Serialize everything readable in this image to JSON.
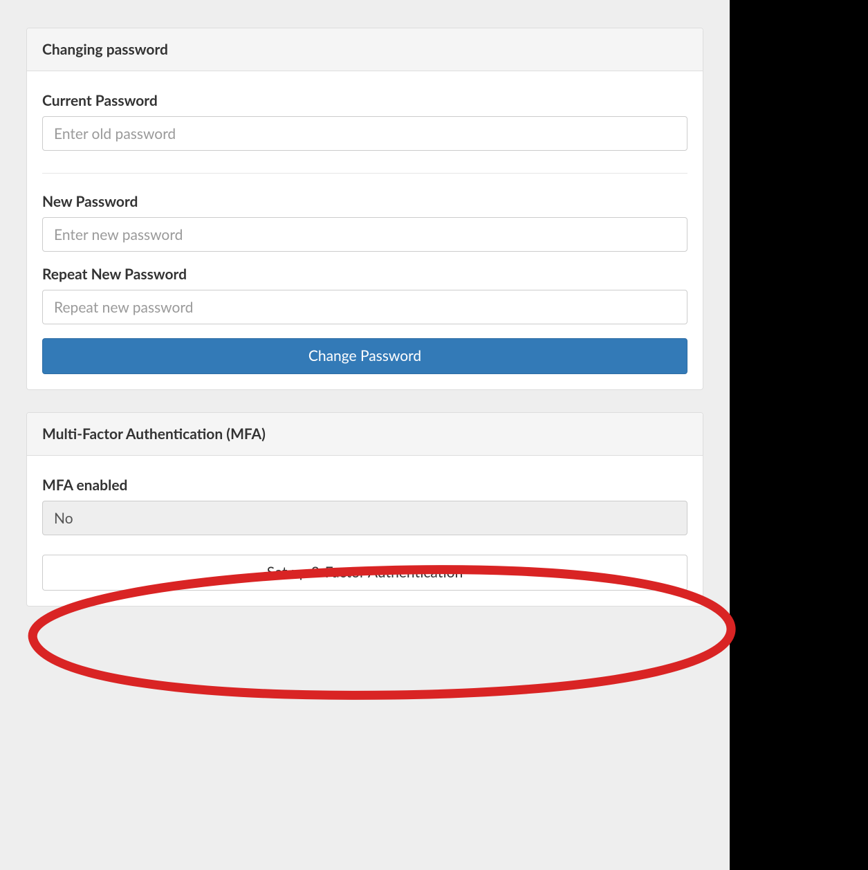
{
  "password_panel": {
    "title": "Changing password",
    "current_password": {
      "label": "Current Password",
      "placeholder": "Enter old password",
      "value": ""
    },
    "new_password": {
      "label": "New Password",
      "placeholder": "Enter new password",
      "value": ""
    },
    "repeat_password": {
      "label": "Repeat New Password",
      "placeholder": "Repeat new password",
      "value": ""
    },
    "submit_label": "Change Password"
  },
  "mfa_panel": {
    "title": "Multi-Factor Authentication (MFA)",
    "enabled_label": "MFA enabled",
    "enabled_value": "No",
    "setup_button_label": "Set up 2-Factor Authentication"
  },
  "colors": {
    "primary": "#337ab7",
    "annotation": "#d92424"
  }
}
